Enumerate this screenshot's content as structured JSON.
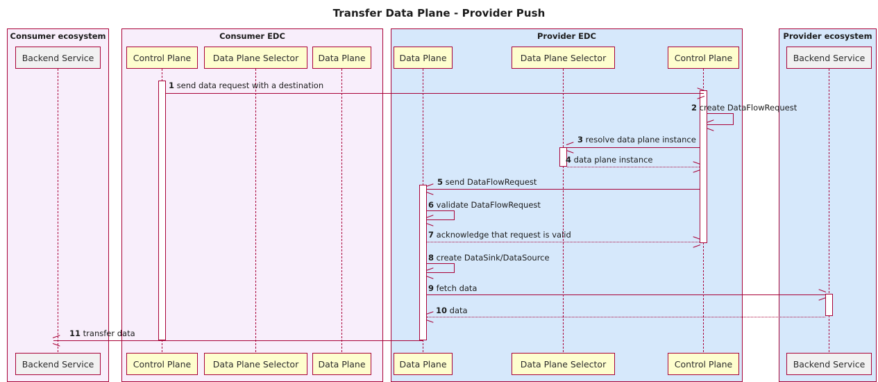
{
  "diagram": {
    "title": "Transfer Data Plane - Provider Push",
    "type": "sequence-diagram",
    "colors": {
      "accent": "#A80036",
      "consumer_group_bg": "#F8EEFB",
      "provider_group_bg": "#D6E8FB",
      "participant_bg": "#FEFECE",
      "actor_bg": "#F1F1F1",
      "text": "#1b1b1b"
    }
  },
  "groups": [
    {
      "id": "consumer-ecosystem",
      "label": "Consumer ecosystem",
      "kind": "consumer"
    },
    {
      "id": "consumer-edc",
      "label": "Consumer EDC",
      "kind": "consumer"
    },
    {
      "id": "provider-edc",
      "label": "Provider EDC",
      "kind": "provider"
    },
    {
      "id": "provider-ecosystem",
      "label": "Provider ecosystem",
      "kind": "provider"
    }
  ],
  "participants": [
    {
      "id": "c-backend",
      "label": "Backend Service",
      "group": "consumer-ecosystem",
      "style": "grey"
    },
    {
      "id": "c-control",
      "label": "Control Plane",
      "group": "consumer-edc",
      "style": "yellow"
    },
    {
      "id": "c-dps",
      "label": "Data Plane Selector",
      "group": "consumer-edc",
      "style": "yellow"
    },
    {
      "id": "c-dataplane",
      "label": "Data Plane",
      "group": "consumer-edc",
      "style": "yellow"
    },
    {
      "id": "p-dataplane",
      "label": "Data Plane",
      "group": "provider-edc",
      "style": "yellow"
    },
    {
      "id": "p-dps",
      "label": "Data Plane Selector",
      "group": "provider-edc",
      "style": "yellow"
    },
    {
      "id": "p-control",
      "label": "Control Plane",
      "group": "provider-edc",
      "style": "yellow"
    },
    {
      "id": "p-backend",
      "label": "Backend Service",
      "group": "provider-ecosystem",
      "style": "grey"
    }
  ],
  "messages": [
    {
      "num": "1",
      "text": "send data request with a destination",
      "from": "c-control",
      "to": "p-control",
      "style": "solid",
      "kind": "call"
    },
    {
      "num": "2",
      "text": "create DataFlowRequest",
      "from": "p-control",
      "to": "p-control",
      "style": "solid",
      "kind": "self"
    },
    {
      "num": "3",
      "text": "resolve data plane instance",
      "from": "p-control",
      "to": "p-dps",
      "style": "solid",
      "kind": "call"
    },
    {
      "num": "4",
      "text": "data plane instance",
      "from": "p-dps",
      "to": "p-control",
      "style": "dotted",
      "kind": "return"
    },
    {
      "num": "5",
      "text": "send DataFlowRequest",
      "from": "p-control",
      "to": "p-dataplane",
      "style": "solid",
      "kind": "call"
    },
    {
      "num": "6",
      "text": "validate DataFlowRequest",
      "from": "p-dataplane",
      "to": "p-dataplane",
      "style": "solid",
      "kind": "self"
    },
    {
      "num": "7",
      "text": "acknowledge that request is valid",
      "from": "p-dataplane",
      "to": "p-control",
      "style": "dotted",
      "kind": "return"
    },
    {
      "num": "8",
      "text": "create DataSink/DataSource",
      "from": "p-dataplane",
      "to": "p-dataplane",
      "style": "solid",
      "kind": "self"
    },
    {
      "num": "9",
      "text": "fetch data",
      "from": "p-dataplane",
      "to": "p-backend",
      "style": "solid",
      "kind": "call"
    },
    {
      "num": "10",
      "text": "data",
      "from": "p-backend",
      "to": "p-dataplane",
      "style": "dotted",
      "kind": "return"
    },
    {
      "num": "11",
      "text": "transfer data",
      "from": "p-dataplane",
      "to": "c-backend",
      "style": "solid",
      "kind": "call"
    }
  ]
}
